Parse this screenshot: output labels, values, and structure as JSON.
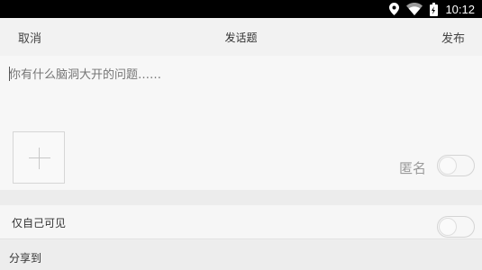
{
  "status_bar": {
    "time": "10:12",
    "icons": [
      "location-icon",
      "wifi-icon",
      "battery-icon"
    ]
  },
  "header": {
    "cancel_label": "取消",
    "title": "发话题",
    "publish_label": "发布"
  },
  "editor": {
    "placeholder": "你有什么脑洞大开的问题……",
    "value": "",
    "add_image_icon": "plus-icon",
    "anonymous_label": "匿名",
    "anonymous_on": false
  },
  "settings": {
    "private_label": "仅自己可见",
    "private_on": false,
    "share_label": "分享到"
  },
  "colors": {
    "status_bar_bg": "#000000",
    "background": "#f0f0f0",
    "placeholder": "#9a9a9a"
  }
}
